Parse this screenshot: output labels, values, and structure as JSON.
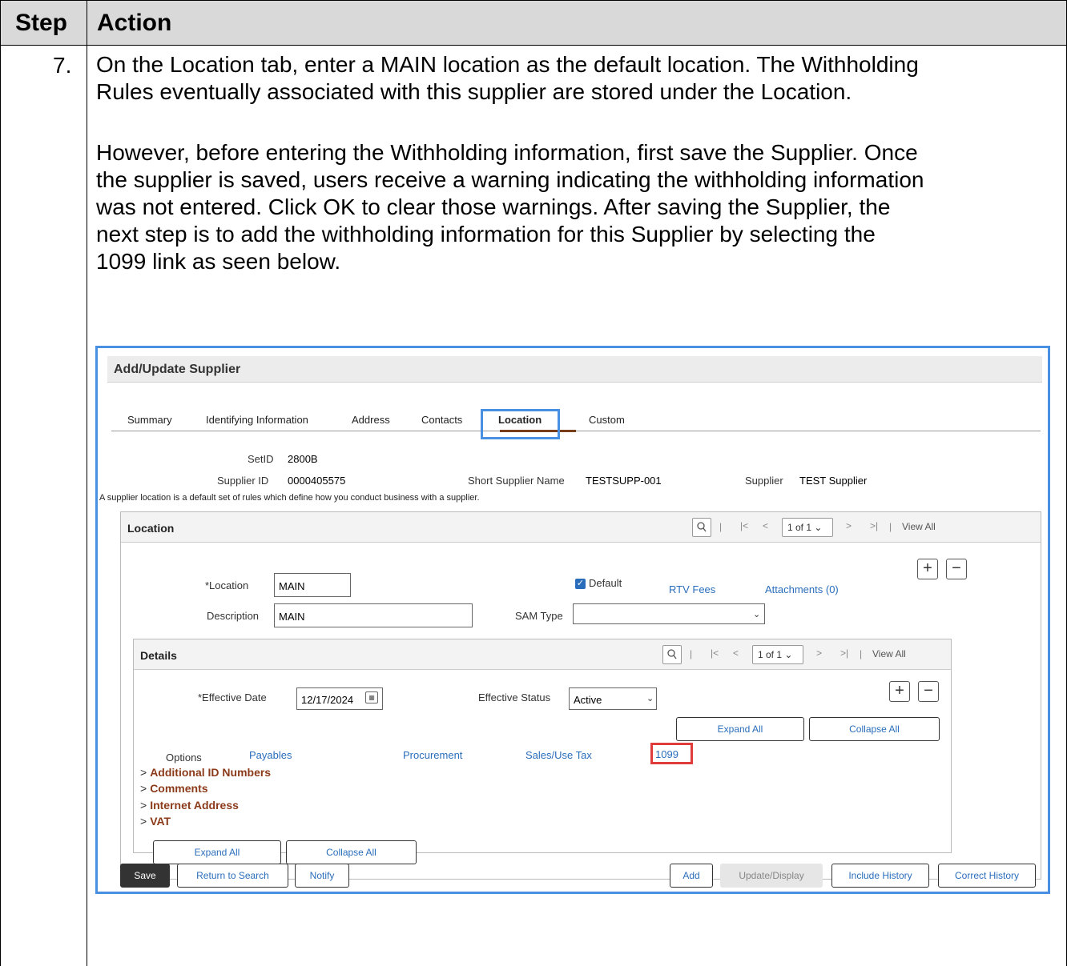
{
  "header": {
    "step": "Step",
    "action": "Action"
  },
  "step_number": "7.",
  "paragraphs": {
    "p1_line1": "On the Location tab, enter a MAIN location as the default location. The Withholding",
    "p1_line2": "Rules eventually associated with this supplier are stored under the Location.",
    "p2_line1": "However, before entering the Withholding information, first save the Supplier. Once",
    "p2_line2": "the supplier is saved, users receive a warning indicating the withholding information",
    "p2_line3": "was not entered. Click OK to clear those warnings. After saving the Supplier, the",
    "p2_line4": "next step is to add the withholding information for this Supplier by selecting the",
    "p2_line5": "1099 link as seen below."
  },
  "screenshot": {
    "page_title": "Add/Update Supplier",
    "tabs": [
      "Summary",
      "Identifying Information",
      "Address",
      "Contacts",
      "Location",
      "Custom"
    ],
    "active_tab": "Location",
    "setid_label": "SetID",
    "setid_value": "2800B",
    "supplier_id_label": "Supplier ID",
    "supplier_id_value": "0000405575",
    "short_name_label": "Short Supplier Name",
    "short_name_value": "TESTSUPP-001",
    "supplier_label": "Supplier",
    "supplier_value": "TEST Supplier",
    "description_text": "A supplier location is a default set of rules which define how you conduct business with a supplier.",
    "location_panel": {
      "title": "Location",
      "page_indicator": "1 of 1",
      "view_all": "View All",
      "location_label": "*Location",
      "location_value": "MAIN",
      "description_label": "Description",
      "description_value": "MAIN",
      "default_label": "Default",
      "default_checked": true,
      "rtv_fees": "RTV Fees",
      "attachments": "Attachments (0)",
      "sam_type_label": "SAM Type",
      "sam_type_value": ""
    },
    "details_panel": {
      "title": "Details",
      "page_indicator": "1 of 1",
      "view_all": "View All",
      "effective_date_label": "*Effective Date",
      "effective_date_value": "12/17/2024",
      "effective_status_label": "Effective Status",
      "effective_status_value": "Active",
      "expand_all": "Expand All",
      "collapse_all": "Collapse All",
      "options_label": "Options",
      "option_links": [
        "Payables",
        "Procurement",
        "Sales/Use Tax",
        "1099"
      ],
      "sections": [
        "Additional ID Numbers",
        "Comments",
        "Internet Address",
        "VAT"
      ],
      "expand_all_bottom": "Expand All",
      "collapse_all_bottom": "Collapse All"
    },
    "footer_buttons": {
      "save": "Save",
      "return_to_search": "Return to Search",
      "notify": "Notify",
      "add": "Add",
      "update_display": "Update/Display",
      "include_history": "Include History",
      "correct_history": "Correct History"
    },
    "colors": {
      "highlight_blue": "#4a90e2",
      "highlight_red": "#e03c3c",
      "link_blue": "#2a6ebb",
      "section_brown": "#8b3a1a"
    }
  }
}
